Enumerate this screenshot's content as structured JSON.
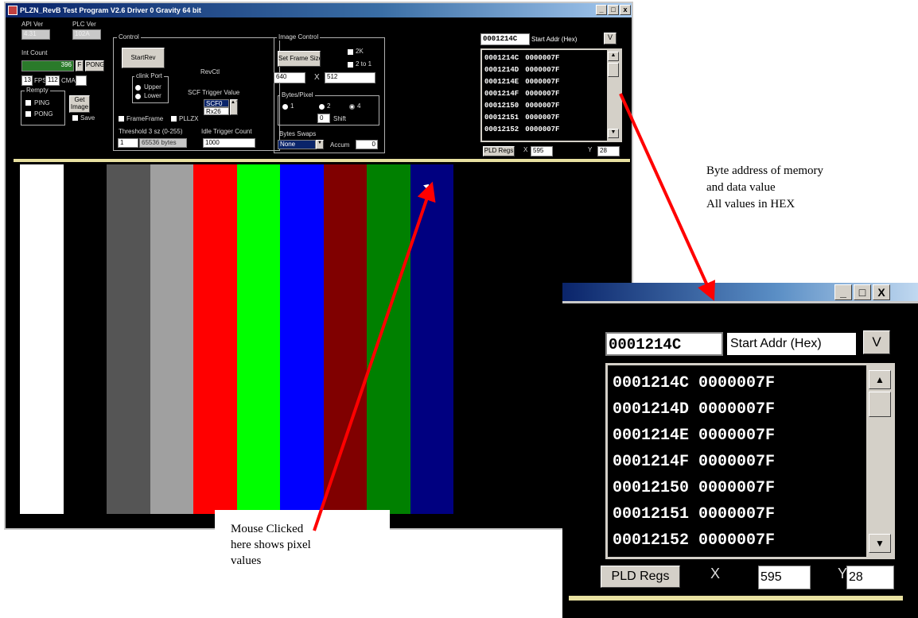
{
  "window": {
    "title": "PLZN_RevB Test Program V2.6   Driver 0  Gravity 64 bit",
    "minimize": "_",
    "maximize": "□",
    "close": "x"
  },
  "versions": {
    "api_label": "API Ver",
    "api_value": "4.31",
    "plc_label": "PLC Ver",
    "plc_value": "102A"
  },
  "int_count": {
    "label": "Int Count",
    "value": "396",
    "f_label": "F",
    "pong_label": "PONG"
  },
  "fps": {
    "value": "13",
    "label": "FPS",
    "second": "112",
    "cma_label": "CMA",
    "cma_value": ""
  },
  "buffers": {
    "label": "Rempty",
    "ping": "PING",
    "pong": "PONG",
    "get_image": "Get Image",
    "save": "Save"
  },
  "control": {
    "label": "Control",
    "start_rev": "StartRev",
    "rev_ctl": "RevCtl",
    "click_port_label": "clink Port",
    "upper": "Upper",
    "lower": "Lower",
    "scf_label": "SCF Trigger Value",
    "scf_value1": "SCF0",
    "scf_value2": "Rx26",
    "frames_label": "FrameFrame",
    "pllzx_label": "PLLZX",
    "threshold_label": "Threshold 3 sz (0-255)",
    "threshold_value": "1",
    "bytes_value": "65536 bytes",
    "idle_label": "Idle Trigger Count",
    "idle_value": "1000"
  },
  "image_control": {
    "label": "Image Control",
    "set_frame": "Set Frame Size",
    "opt_2k": "2K",
    "opt_2to1": "2 to 1",
    "width": "640",
    "x": "X",
    "height": "512",
    "bpp_label": "Bytes/Pixel",
    "bpp_1": "1",
    "bpp_2": "2",
    "bpp_4": "4",
    "shift_value": "0",
    "shift_label": "Shift",
    "swap_label": "Bytes Swaps",
    "swap_value": "None",
    "accum_label": "Accum",
    "accum_value": "0"
  },
  "memory": {
    "start_addr": "0001214C",
    "start_label": "Start Addr (Hex)",
    "v_button": "V",
    "rows": [
      {
        "addr": "0001214C",
        "value": "0000007F"
      },
      {
        "addr": "0001214D",
        "value": "0000007F"
      },
      {
        "addr": "0001214E",
        "value": "0000007F"
      },
      {
        "addr": "0001214F",
        "value": "0000007F"
      },
      {
        "addr": "00012150",
        "value": "0000007F"
      },
      {
        "addr": "00012151",
        "value": "0000007F"
      },
      {
        "addr": "00012152",
        "value": "0000007F"
      }
    ],
    "pld_regs": "PLD Regs",
    "x_label": "X",
    "x_value": "595",
    "y_label": "Y",
    "y_value": "28"
  },
  "color_bars": [
    "#ffffff",
    "#000000",
    "#555555",
    "#a0a0a0",
    "#ff0000",
    "#00ff00",
    "#0000ff",
    "#800000",
    "#008000",
    "#000080",
    "#000000"
  ],
  "annotations": {
    "mouse_1": "Mouse Clicked",
    "mouse_2": "here shows pixel",
    "mouse_3": "values",
    "byte_1": "Byte address of memory",
    "byte_2": "and data value",
    "byte_3": "All  values in HEX"
  },
  "zoom": {
    "minimize": "_",
    "maximize": "□",
    "close": "X"
  },
  "colors": {
    "arrow": "#ff0000",
    "accent_line": "#e8e0a0"
  }
}
